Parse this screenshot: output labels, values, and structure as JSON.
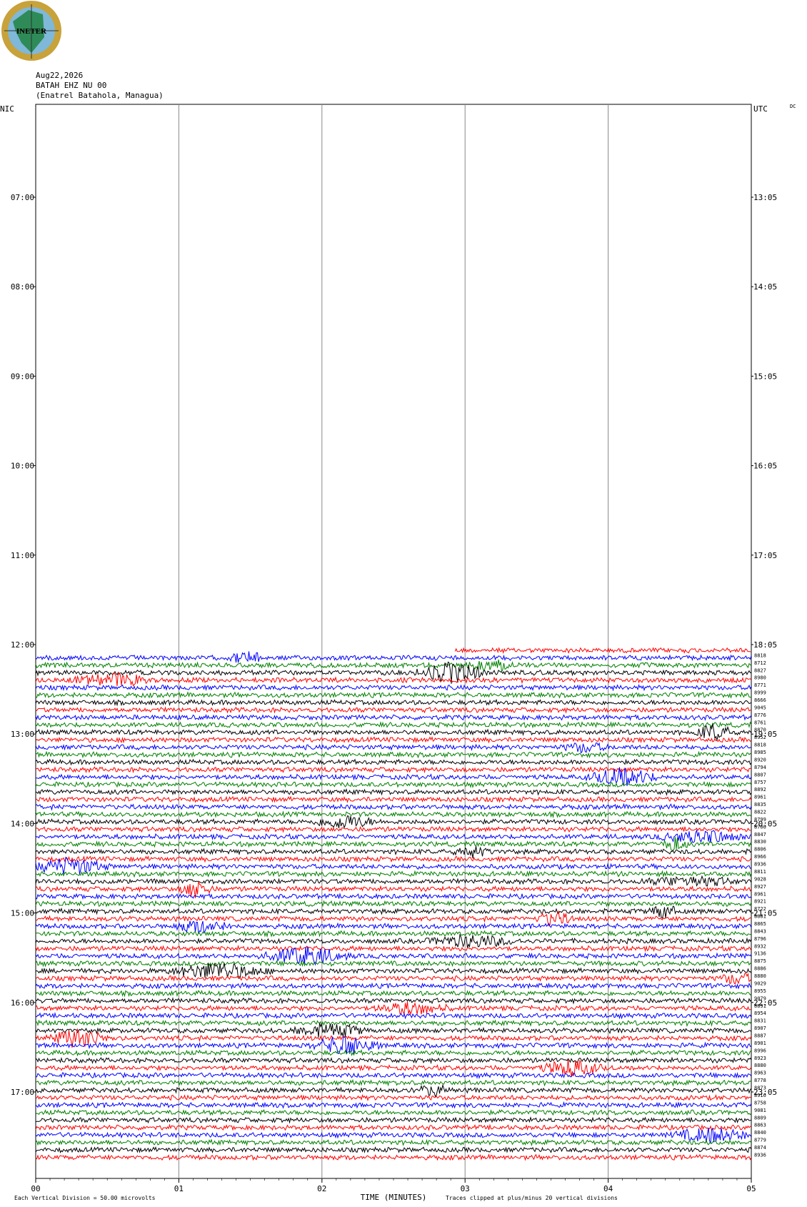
{
  "logo": {
    "text": "INETER",
    "colors": {
      "ring": "#c8a23a",
      "sea": "#7fb8d8",
      "land": "#2e8b57"
    }
  },
  "header": {
    "date": "Aug22,2026",
    "station": "BATAH EHZ NU 00",
    "location": "(Enatrel Batahola, Managua)"
  },
  "chart_data": {
    "type": "line",
    "description_kind": "helicorder",
    "left_axis_title": "NIC",
    "right_axis_title": "UTC",
    "corner_label": "DC",
    "left_times": [
      "07:00",
      "08:00",
      "09:00",
      "10:00",
      "11:00",
      "12:00",
      "13:00",
      "14:00",
      "15:00",
      "16:00",
      "17:00"
    ],
    "right_times": [
      "13:05",
      "14:05",
      "15:05",
      "16:05",
      "17:05",
      "18:05",
      "19:05",
      "20:05",
      "21:05",
      "22:05",
      "23:05"
    ],
    "x_ticks": [
      "00",
      "01",
      "02",
      "03",
      "04",
      "05"
    ],
    "xlabel": "TIME (MINUTES)",
    "x_range_minutes": [
      0,
      5
    ],
    "trace_interval_minutes": 5,
    "first_row_start_local": "06:00",
    "data_start_minute_first_trace": 2.93,
    "trace_colors": [
      "#ff0000",
      "#0000ff",
      "#008000",
      "#000000"
    ],
    "trace_values": [
      "8818",
      "8712",
      "8827",
      "8980",
      "8771",
      "8999",
      "8666",
      "9045",
      "8776",
      "8761",
      "8870",
      "8952",
      "8818",
      "8985",
      "8920",
      "8794",
      "8807",
      "8757",
      "8892",
      "8961",
      "8835",
      "8822",
      "8799",
      "8700",
      "8847",
      "8830",
      "8806",
      "8966",
      "8936",
      "8811",
      "9028",
      "8927",
      "8961",
      "8921",
      "8722",
      "8881",
      "8865",
      "8843",
      "8796",
      "8932",
      "9136",
      "8875",
      "8886",
      "8880",
      "9029",
      "8955",
      "9079",
      "8891",
      "8954",
      "8831",
      "8907",
      "8887",
      "8901",
      "8996",
      "8923",
      "8880",
      "8963",
      "8778",
      "8873",
      "8916",
      "8758",
      "9081",
      "8809",
      "8863",
      "8840",
      "8779",
      "8874",
      "8936"
    ],
    "footer_scale": "Each Vertical Division =    50.00 microvolts",
    "footer_clip": "Traces clipped at plus/minus 20 vertical divisions"
  }
}
